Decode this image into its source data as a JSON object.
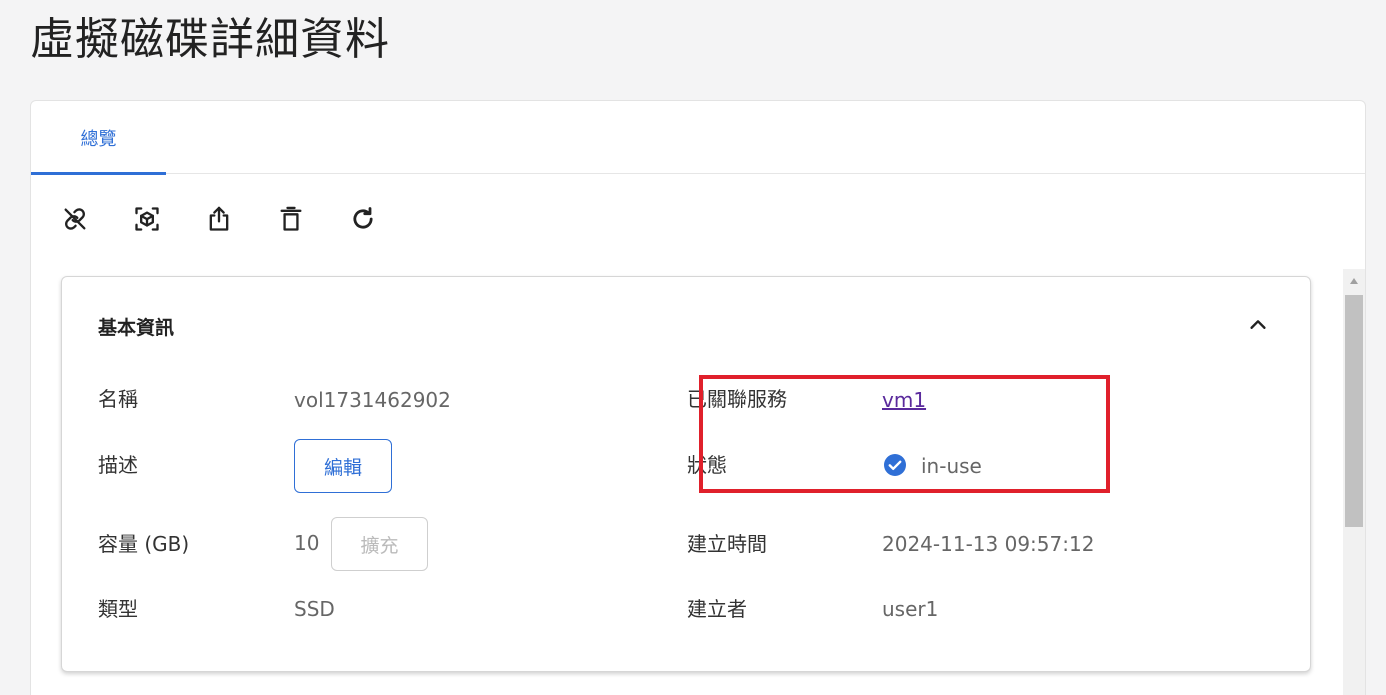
{
  "page": {
    "title": "虛擬磁碟詳細資料"
  },
  "tabs": [
    {
      "label": "總覽",
      "active": true
    }
  ],
  "toolbar": {
    "icons": [
      "unlink-icon",
      "snapshot-cube-icon",
      "share-upload-icon",
      "trash-icon",
      "refresh-icon"
    ]
  },
  "basic_info": {
    "title": "基本資訊",
    "name_label": "名稱",
    "name_value": "vol1731462902",
    "description_label": "描述",
    "edit_button": "編輯",
    "capacity_label": "容量 (GB)",
    "capacity_value": "10",
    "expand_button": "擴充",
    "type_label": "類型",
    "type_value": "SSD",
    "service_label": "已關聯服務",
    "service_value": "vm1",
    "status_label": "狀態",
    "status_value": "in-use",
    "created_time_label": "建立時間",
    "created_time_value": "2024-11-13 09:57:12",
    "creator_label": "建立者",
    "creator_value": "user1"
  },
  "colors": {
    "accent": "#2f6fd6",
    "highlight": "#e0202b",
    "link_visited": "#5a2a9c",
    "status_ok": "#2f6fd6"
  }
}
